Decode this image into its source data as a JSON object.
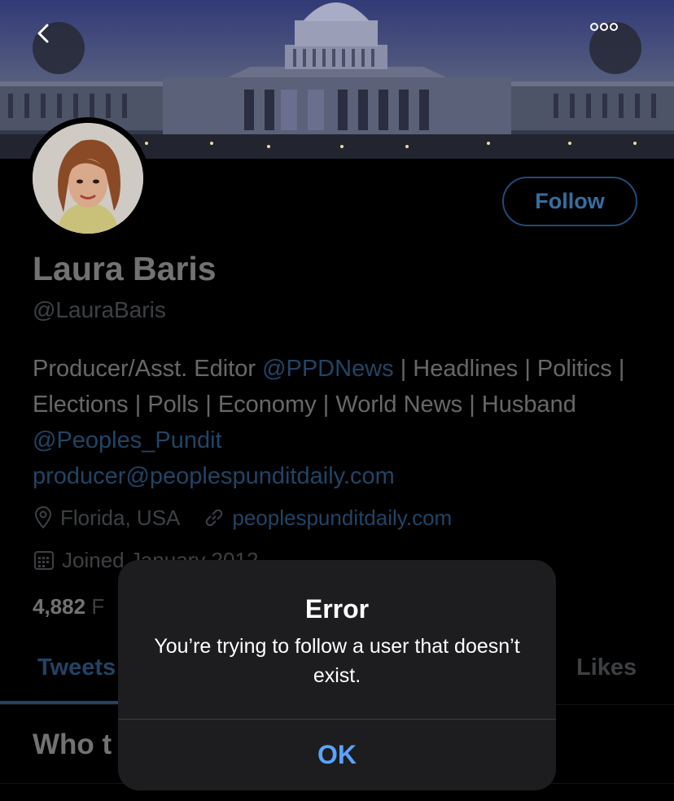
{
  "banner": {
    "alt": "Capitol building banner"
  },
  "nav": {
    "back_icon": "chevron-left-icon",
    "more_icon": "ellipsis-icon"
  },
  "profile": {
    "name": "Laura Baris",
    "handle": "@LauraBaris",
    "follow_label": "Follow",
    "bio": {
      "part1": "Producer/Asst. Editor ",
      "link1": "@PPDNews",
      "part2": " | Headlines | Politics | Elections | Polls | Economy | World News | Husband ",
      "link2": "@Peoples_Pundit",
      "email": "producer@peoplespunditdaily.com"
    },
    "location": "Florida, USA",
    "website": "peoplespunditdaily.com",
    "joined": "Joined January 2012",
    "following_count": "4,882",
    "following_label": "F"
  },
  "tabs": {
    "tweets": "Tweets",
    "likes": "Likes"
  },
  "section": {
    "who": "Who t"
  },
  "dialog": {
    "title": "Error",
    "message": "You’re trying to follow a user that doesn’t exist.",
    "ok": "OK"
  },
  "colors": {
    "accent": "#4a99e0",
    "background": "#000000",
    "dialog": "#1d1d1f"
  }
}
